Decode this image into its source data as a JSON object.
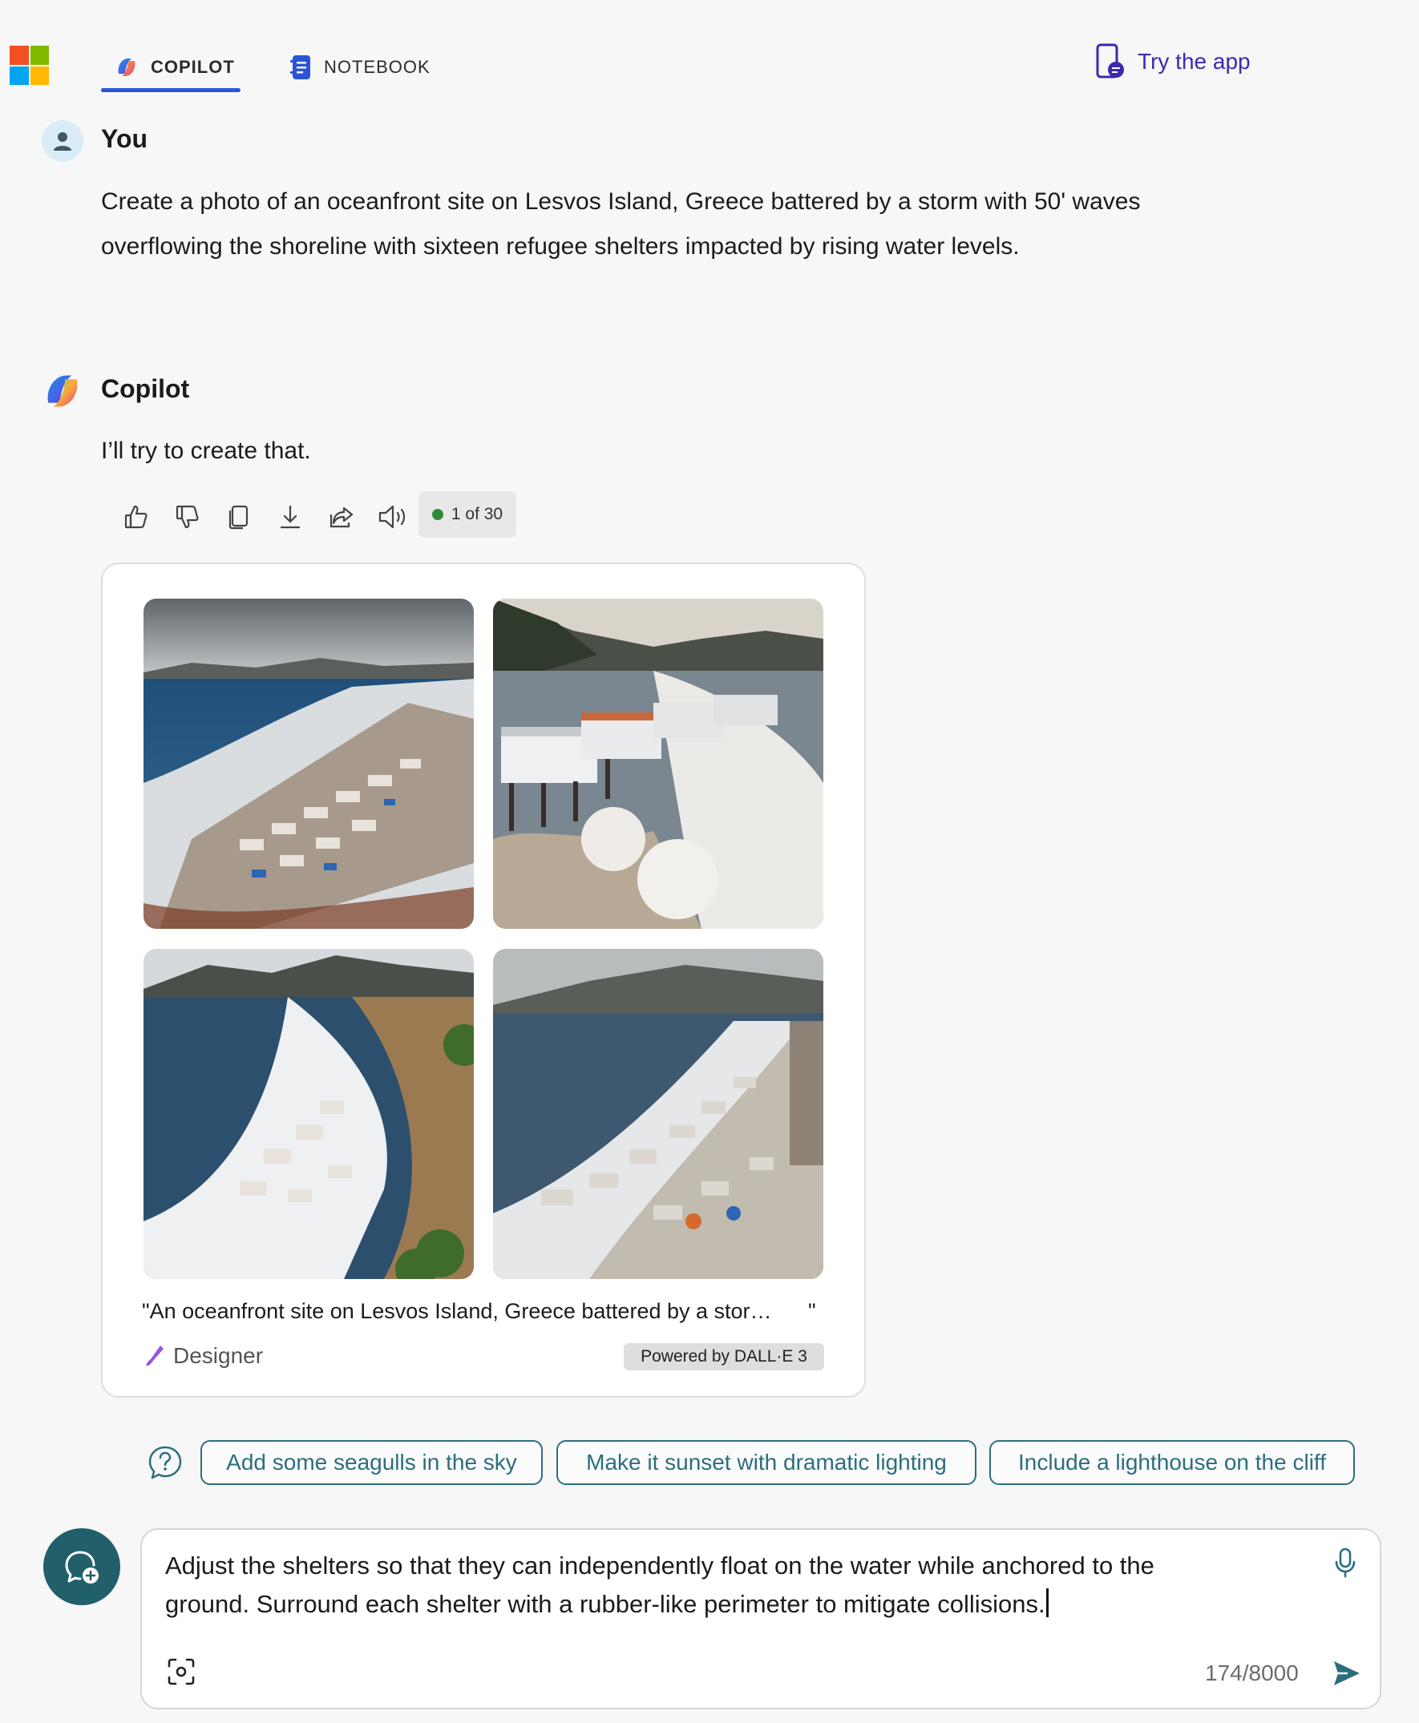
{
  "header": {
    "tabs": [
      {
        "label": "COPILOT",
        "active": true
      },
      {
        "label": "NOTEBOOK",
        "active": false
      }
    ],
    "try_app_label": "Try the app"
  },
  "conversation": {
    "user": {
      "name": "You",
      "line1": "Create a photo of an oceanfront site on Lesvos Island, Greece battered by a storm with 50' waves",
      "line2": "overflowing the shoreline with sixteen refugee shelters impacted by rising water levels."
    },
    "assistant": {
      "name": "Copilot",
      "reply": "I’ll try to create that.",
      "actions": [
        "thumbs-up-icon",
        "thumbs-down-icon",
        "copy-icon",
        "download-icon",
        "share-icon",
        "read-aloud-icon"
      ],
      "response_counter": "1 of 30"
    }
  },
  "image_card": {
    "caption": "\"An oceanfront site on Lesvos Island, Greece battered by a stor…",
    "caption_end": "\"",
    "designer_label": "Designer",
    "powered_label": "Powered by DALL·E 3"
  },
  "suggestions": [
    "Add some seagulls in the sky",
    "Make it sunset with dramatic lighting",
    "Include a lighthouse on the cliff"
  ],
  "composer": {
    "line1": "Adjust the shelters so that they can independently float on the water while anchored to the",
    "line2": "ground. Surround each shelter with a rubber-like perimeter to mitigate collisions.",
    "char_count": "174/8000"
  },
  "colors": {
    "accent_blue": "#2a54d6",
    "try_app": "#3b2ab0",
    "teal": "#2c6e7e",
    "new_topic_bg": "#215f6b"
  }
}
